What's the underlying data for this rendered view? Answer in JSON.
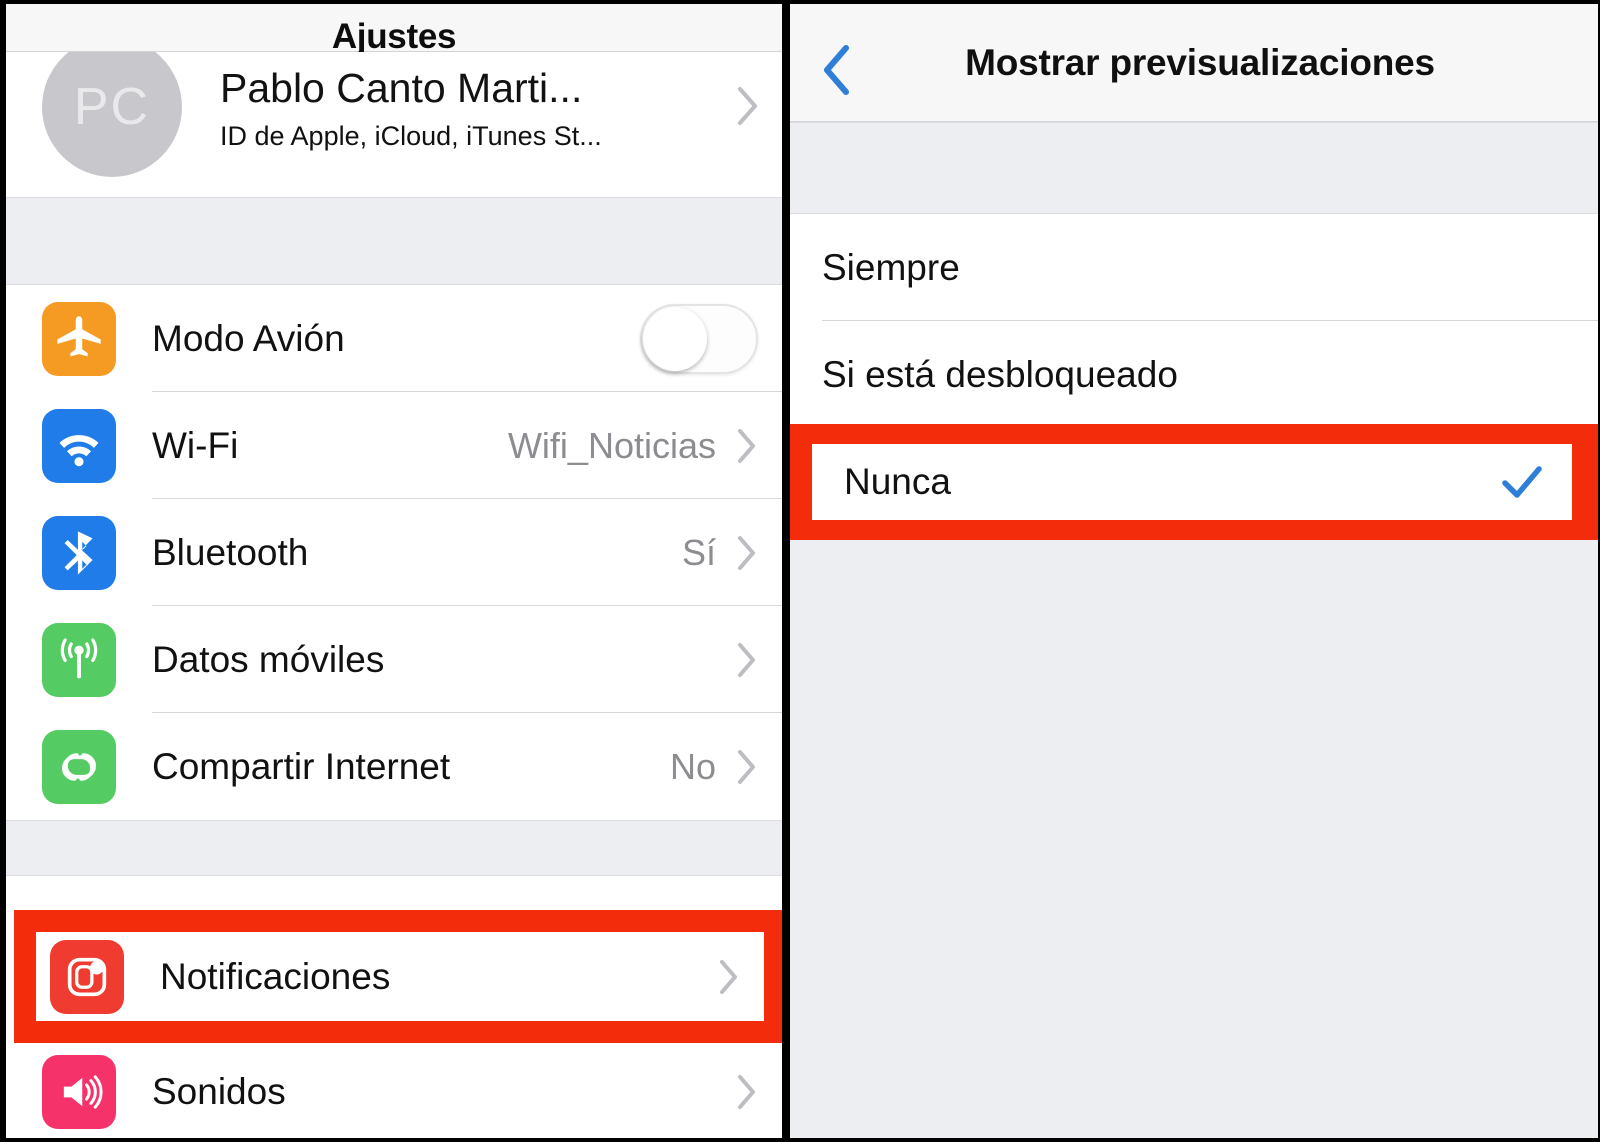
{
  "left_panel": {
    "nav_title": "Ajustes",
    "profile": {
      "avatar_initials": "PC",
      "name": "Pablo Canto Marti...",
      "subtitle": "ID de Apple, iCloud, iTunes St...",
      "chevron_icon": "chevron-right-icon"
    },
    "connectivity_rows": [
      {
        "label": "Modo Avión",
        "value": "",
        "icon": "airplane-icon",
        "icon_color": "#f59a23",
        "control": "toggle",
        "toggle_on": false
      },
      {
        "label": "Wi-Fi",
        "value": "Wifi_Noticias",
        "icon": "wifi-icon",
        "icon_color": "#1f7ce8",
        "control": "chevron"
      },
      {
        "label": "Bluetooth",
        "value": "Sí",
        "icon": "bluetooth-icon",
        "icon_color": "#1f7ce8",
        "control": "chevron"
      },
      {
        "label": "Datos móviles",
        "value": "",
        "icon": "cellular-antenna-icon",
        "icon_color": "#54cb63",
        "control": "chevron"
      },
      {
        "label": "Compartir Internet",
        "value": "No",
        "icon": "hotspot-link-icon",
        "icon_color": "#54cb63",
        "control": "chevron"
      }
    ],
    "notifications_row": {
      "label": "Notificaciones",
      "value": "",
      "icon": "notifications-icon",
      "icon_color": "#ef3b30",
      "control": "chevron",
      "highlighted": true,
      "highlight_color": "#f32c0c"
    },
    "sounds_row": {
      "label": "Sonidos",
      "value": "",
      "icon": "speaker-sound-icon",
      "icon_color": "#f5326a",
      "control": "chevron"
    }
  },
  "right_panel": {
    "back_icon": "chevron-left-icon",
    "back_color": "#2f7ed8",
    "nav_title": "Mostrar previsualizaciones",
    "options": [
      {
        "label": "Siempre",
        "selected": false
      },
      {
        "label": "Si está desbloqueado",
        "selected": false
      }
    ],
    "selected_option": {
      "label": "Nunca",
      "selected": true,
      "check_icon": "checkmark-icon",
      "check_color": "#2f7ed8",
      "highlighted": true,
      "highlight_color": "#f32c0c"
    }
  }
}
